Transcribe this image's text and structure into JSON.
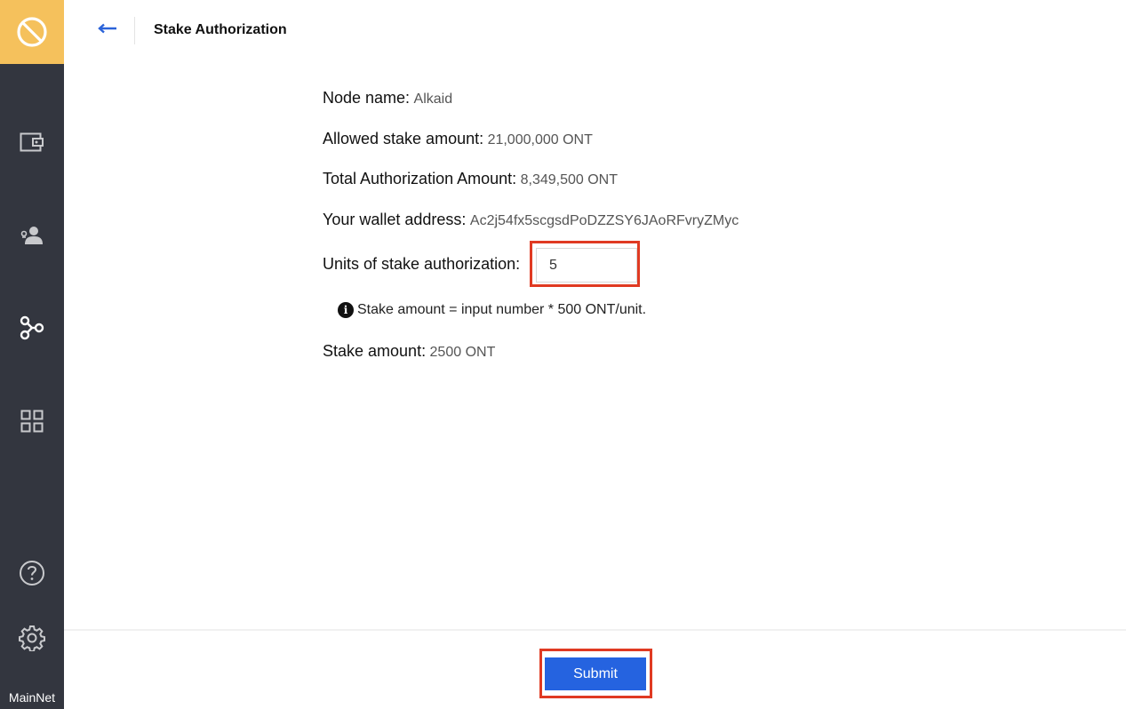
{
  "sidebar": {
    "logo_icon": "ontology-logo-icon",
    "items": [
      {
        "name": "wallet",
        "icon": "wallet-icon"
      },
      {
        "name": "identity",
        "icon": "user-icon"
      },
      {
        "name": "node-stake",
        "icon": "nodes-icon"
      },
      {
        "name": "apps",
        "icon": "grid-icon"
      },
      {
        "name": "help",
        "icon": "help-icon"
      },
      {
        "name": "settings",
        "icon": "gear-icon"
      }
    ],
    "network": "MainNet"
  },
  "header": {
    "back_icon": "arrow-left-icon",
    "title": "Stake Authorization"
  },
  "form": {
    "node_name_label": "Node name:",
    "node_name_value": "Alkaid",
    "allowed_label": "Allowed stake amount:",
    "allowed_value": "21,000,000 ONT",
    "total_label": "Total Authorization Amount:",
    "total_value": "8,349,500 ONT",
    "wallet_label": "Your wallet address:",
    "wallet_value": "Ac2j54fx5scgsdPoDZZSY6JAoRFvryZMyc",
    "units_label": "Units of stake authorization:",
    "units_value": "5",
    "hint_icon": "info-icon",
    "hint_text": "Stake amount = input number * 500 ONT/unit.",
    "stake_label": "Stake amount:",
    "stake_value": "2500 ONT"
  },
  "footer": {
    "submit_label": "Submit"
  },
  "colors": {
    "sidebar_bg": "#33363f",
    "logo_bg": "#f5c15c",
    "primary": "#2563e0",
    "highlight": "#e03a22"
  }
}
